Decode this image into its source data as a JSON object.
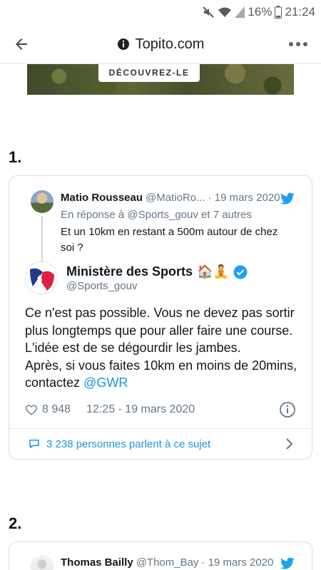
{
  "status_bar": {
    "battery": "16%",
    "time": "21:24"
  },
  "browser": {
    "url": "Topito.com"
  },
  "banner": {
    "button_label": "DÉCOUVREZ-LE"
  },
  "items": [
    {
      "number": "1.",
      "reply": {
        "name": "Matio Rousseau",
        "handle": "@MatioRo...",
        "date": "· 19 mars 2020",
        "reply_to": "En réponse à @Sports_gouv et 7 autres",
        "text": "Et un 10km en restant a 500m autour de chez soi ?"
      },
      "tweet": {
        "name": "Ministère des Sports",
        "emojis": "🏠🧘",
        "handle": "@Sports_gouv",
        "text_lines": [
          "Ce n'est pas possible. Vous ne devez pas sortir",
          "plus longtemps que pour aller faire une course.",
          "L'idée est de se dégourdir les jambes.",
          "Après, si vous faites 10km en moins de 20mins,",
          "contactez"
        ],
        "mention": "@GWR",
        "likes": "8 948",
        "timestamp": "12:25 - 19 mars 2020",
        "conversation": "3 238 personnes parlent à ce sujet"
      }
    },
    {
      "number": "2.",
      "reply": {
        "name": "Thomas Bailly",
        "handle": "@Thom_Bay",
        "date": "· 19 mars 2020"
      }
    }
  ],
  "colors": {
    "twitter_blue": "#1b95e0",
    "verified": "#1da1f2",
    "muted": "#657786"
  }
}
